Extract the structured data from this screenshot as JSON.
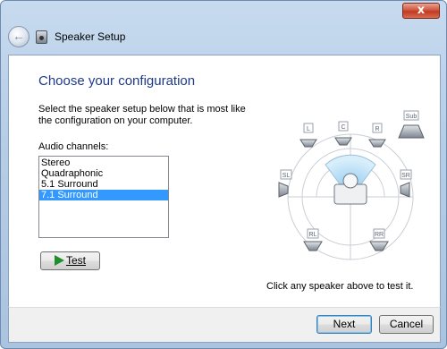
{
  "window": {
    "title": "Speaker Setup",
    "close_glyph": "x"
  },
  "main": {
    "heading": "Choose your configuration",
    "instructions_line1": "Select the speaker setup below that is most like",
    "instructions_line2": "the configuration on your computer.",
    "audio_channels_label": "Audio channels:",
    "channels": [
      {
        "label": "Stereo",
        "selected": false
      },
      {
        "label": "Quadraphonic",
        "selected": false
      },
      {
        "label": "5.1 Surround",
        "selected": false
      },
      {
        "label": "7.1 Surround",
        "selected": true
      }
    ],
    "test_button": "Test",
    "hint": "Click any speaker above to test it."
  },
  "diagram": {
    "speakers": {
      "left": "L",
      "center": "C",
      "right": "R",
      "sub": "Sub",
      "side_left": "SL",
      "side_right": "SR",
      "rear_left": "RL",
      "rear_right": "RR"
    }
  },
  "footer": {
    "next_label": "Next",
    "cancel_label": "Cancel"
  },
  "colors": {
    "heading": "#1e3a8a",
    "selection": "#3399ff",
    "test_play": "#1f8f2a"
  },
  "icons": {
    "back": "back-arrow-icon",
    "app": "speaker-icon",
    "test": "play-icon"
  }
}
